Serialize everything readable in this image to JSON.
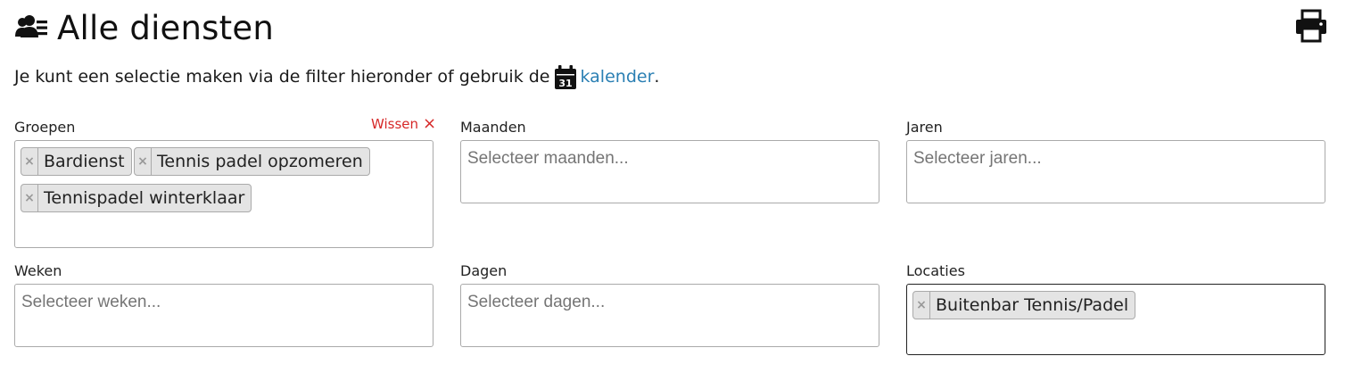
{
  "header": {
    "title": "Alle diensten",
    "title_icon": "users-list-icon",
    "print_icon": "printer-icon"
  },
  "intro": {
    "text": "Je kunt een selectie maken via de filter hieronder of gebruik de",
    "calendar_icon": "calendar-icon",
    "calendar_icon_number": "31",
    "link_text": "kalender",
    "suffix": "."
  },
  "filters": {
    "groepen": {
      "label": "Groepen",
      "clear_label": "Wissen",
      "clear_icon": "×",
      "selected": [
        "Bardienst",
        "Tennis padel opzomeren",
        "Tennispadel winterklaar"
      ]
    },
    "maanden": {
      "label": "Maanden",
      "placeholder": "Selecteer maanden..."
    },
    "jaren": {
      "label": "Jaren",
      "placeholder": "Selecteer jaren..."
    },
    "weken": {
      "label": "Weken",
      "placeholder": "Selecteer weken..."
    },
    "dagen": {
      "label": "Dagen",
      "placeholder": "Selecteer dagen..."
    },
    "locaties": {
      "label": "Locaties",
      "selected": [
        "Buitenbar Tennis/Padel"
      ]
    }
  },
  "chip_remove_glyph": "×",
  "colors": {
    "link": "#2a7fb3",
    "clear": "#d62828",
    "chip_bg": "#e4e4e4",
    "border": "#aaaaaa"
  }
}
